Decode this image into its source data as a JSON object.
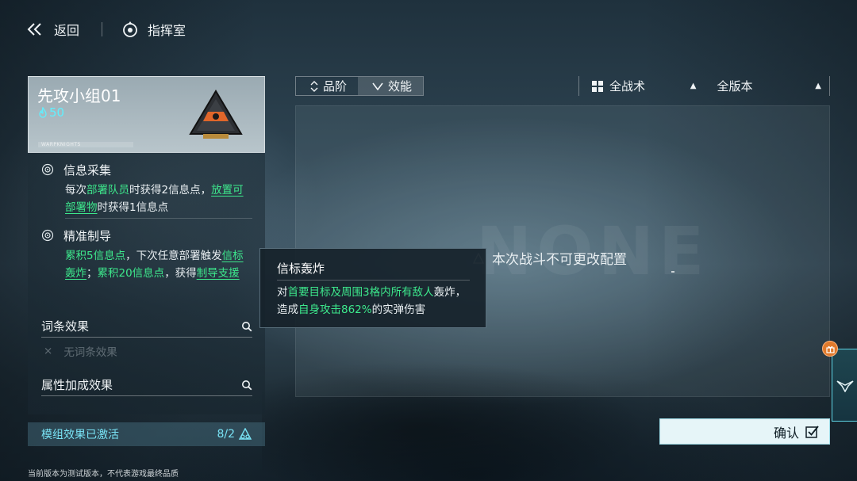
{
  "topbar": {
    "back_label": "返回",
    "command_label": "指挥室"
  },
  "card": {
    "title": "先攻小组01",
    "cost": "50",
    "brand": "WARPKNIGHTS"
  },
  "skills": [
    {
      "name": "信息采集",
      "desc_parts": [
        {
          "t": "每次",
          "s": "normal"
        },
        {
          "t": "部署队员",
          "s": "hl"
        },
        {
          "t": "时获得2信息点，",
          "s": "normal"
        },
        {
          "t": "放置可部署物",
          "s": "hl-u"
        },
        {
          "t": "时获得1信息点",
          "s": "normal"
        }
      ]
    },
    {
      "name": "精准制导",
      "desc_parts": [
        {
          "t": "累积5信息点",
          "s": "hl"
        },
        {
          "t": "，下次任意部署触发",
          "s": "normal"
        },
        {
          "t": "信标轰炸",
          "s": "hl-u"
        },
        {
          "t": "；",
          "s": "normal"
        },
        {
          "t": "累积20信息点",
          "s": "hl"
        },
        {
          "t": "，获得",
          "s": "normal"
        },
        {
          "t": "制导支援",
          "s": "hl-u"
        }
      ]
    }
  ],
  "sections": {
    "affix_label": "词条效果",
    "affix_empty": "无词条效果",
    "attr_label": "属性加成效果"
  },
  "activated": {
    "label": "模组效果已激活",
    "count": "8/2"
  },
  "footer_note": "当前版本为测试版本，不代表游戏最终品质",
  "filters": {
    "grade_label": "品阶",
    "efficiency_label": "效能",
    "tactic_label": "全战术",
    "version_label": "全版本"
  },
  "content": {
    "watermark": "NONE",
    "message": "本次战斗不可更改配置"
  },
  "tooltip": {
    "title": "信标轰炸",
    "desc_parts": [
      {
        "t": "对",
        "s": "normal"
      },
      {
        "t": "首要目标及周围3格内所有敌人",
        "s": "hl"
      },
      {
        "t": "轰炸，造成",
        "s": "normal"
      },
      {
        "t": "自身攻击862%",
        "s": "hl"
      },
      {
        "t": "的实弹伤害",
        "s": "normal"
      }
    ]
  },
  "confirm": {
    "label": "确认"
  },
  "colors": {
    "highlight": "#3de88c",
    "cost": "#5ff0ff",
    "activated": "#79e3f5",
    "badge": "#e07a2c"
  },
  "icons": [
    "back-chevron-icon",
    "command-room-icon",
    "skill-target-icon",
    "search-icon",
    "activation-icon",
    "sort-icon",
    "grid-icon",
    "triangle-up-icon",
    "flight-icon",
    "gift-icon",
    "checkbox-icon"
  ]
}
